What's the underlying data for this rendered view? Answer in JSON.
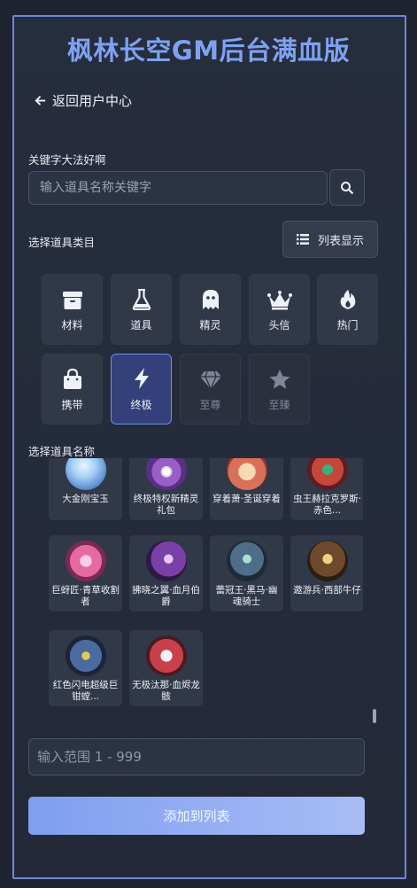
{
  "title": "枫林长空GM后台满血版",
  "back_label": "返回用户中心",
  "search": {
    "label": "关键字大法好啊",
    "placeholder": "输入道具名称关键字"
  },
  "category_label": "选择道具类目",
  "list_toggle_label": "列表显示",
  "categories": [
    {
      "label": "材料",
      "icon": "box-icon",
      "state": "normal"
    },
    {
      "label": "道具",
      "icon": "flask-icon",
      "state": "normal"
    },
    {
      "label": "精灵",
      "icon": "ghost-icon",
      "state": "normal"
    },
    {
      "label": "头信",
      "icon": "crown-icon",
      "state": "normal"
    },
    {
      "label": "热门",
      "icon": "fire-icon",
      "state": "normal"
    },
    {
      "label": "携带",
      "icon": "bag-icon",
      "state": "normal"
    },
    {
      "label": "终极",
      "icon": "bolt-icon",
      "state": "active"
    },
    {
      "label": "至尊",
      "icon": "gem-icon",
      "state": "disabled"
    },
    {
      "label": "至臻",
      "icon": "star-icon",
      "state": "disabled"
    }
  ],
  "item_label": "选择道具名称",
  "items": [
    {
      "name": "大金刚宝玉",
      "color": "#8fb8e6"
    },
    {
      "name": "终极特权新精灵礼包",
      "color": "#9a5fc7"
    },
    {
      "name": "穿着萧·圣诞穿着",
      "color": "#d9705a"
    },
    {
      "name": "虫王赫拉克罗斯·赤色...",
      "color": "#c4473a"
    },
    {
      "name": "巨蚜匠·青草收割者",
      "color": "#e56aa0"
    },
    {
      "name": "拂晓之翼·血月伯爵",
      "color": "#7b3fa8"
    },
    {
      "name": "蕾冠王·黑马·幽魂骑士",
      "color": "#4f6d86"
    },
    {
      "name": "邀游兵·西部牛仔",
      "color": "#6d4a2b"
    },
    {
      "name": "红色闪电超级巨钳螳...",
      "color": "#4a6aa0"
    },
    {
      "name": "无极汰那·血烬龙骸",
      "color": "#c8404a"
    }
  ],
  "quantity": {
    "placeholder": "输入范围 1 - 999"
  },
  "add_button_label": "添加到列表",
  "colors": {
    "accent": "#7ea2f2",
    "frame_border": "#6f87d8",
    "active_category": "#33407a"
  }
}
